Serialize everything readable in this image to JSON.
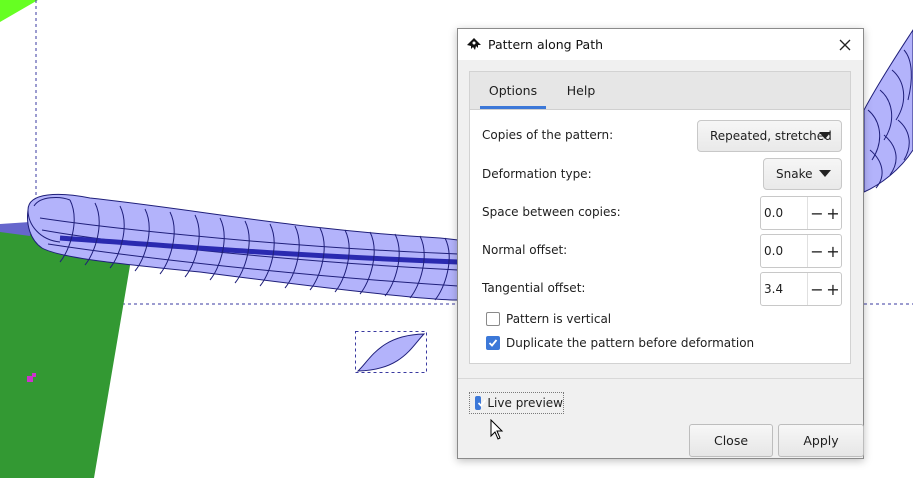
{
  "dialog": {
    "title": "Pattern along Path",
    "tabs": [
      {
        "label": "Options",
        "active": true
      },
      {
        "label": "Help",
        "active": false
      }
    ],
    "rows": {
      "copies": {
        "label": "Copies of the pattern:",
        "value": "Repeated, stretched"
      },
      "deformation": {
        "label": "Deformation type:",
        "value": "Snake"
      },
      "space": {
        "label": "Space between copies:",
        "value": "0.0"
      },
      "normal": {
        "label": "Normal offset:",
        "value": "0.0"
      },
      "tangential": {
        "label": "Tangential offset:",
        "value": "3.4"
      }
    },
    "checks": {
      "vertical": {
        "label": "Pattern is vertical",
        "checked": false
      },
      "duplicate": {
        "label": "Duplicate the pattern before deformation",
        "checked": true
      }
    },
    "live_preview": {
      "label": "Live preview",
      "checked": true
    },
    "buttons": {
      "close": "Close",
      "apply": "Apply"
    },
    "icons": {
      "app": "inkscape-icon",
      "close": "close-icon",
      "spin_minus": "minus-icon",
      "spin_plus": "plus-icon"
    }
  },
  "colors": {
    "accent": "#3c78d8",
    "rope_fill": "#b3b3fb",
    "rope_stroke": "#1f1f7a",
    "green_shape": "#339933",
    "lime_shape": "#66ff22",
    "selection_dash": "#3a3aa0"
  }
}
